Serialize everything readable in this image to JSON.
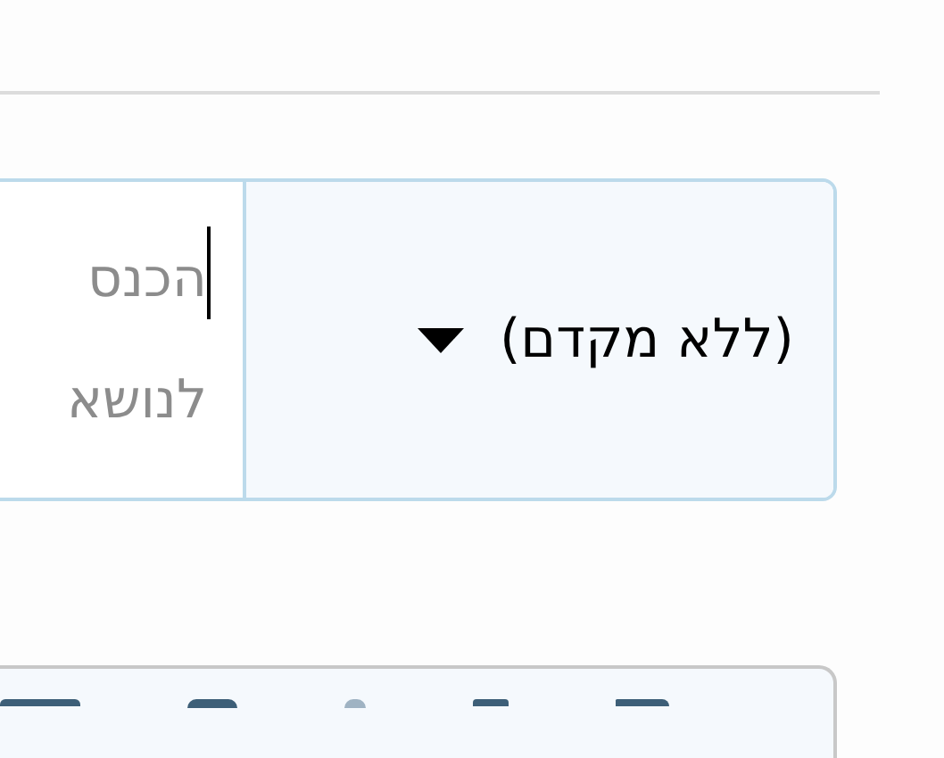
{
  "subject_field": {
    "prefix_select": {
      "value": "(ללא מקדם)"
    },
    "placeholder": "הכנס לנושא",
    "focused": true
  },
  "toolbar": {
    "buttons": [
      {
        "kind": "bar"
      },
      {
        "kind": "circle"
      },
      {
        "kind": "dot"
      },
      {
        "kind": "square"
      },
      {
        "kind": "rounded"
      }
    ]
  }
}
